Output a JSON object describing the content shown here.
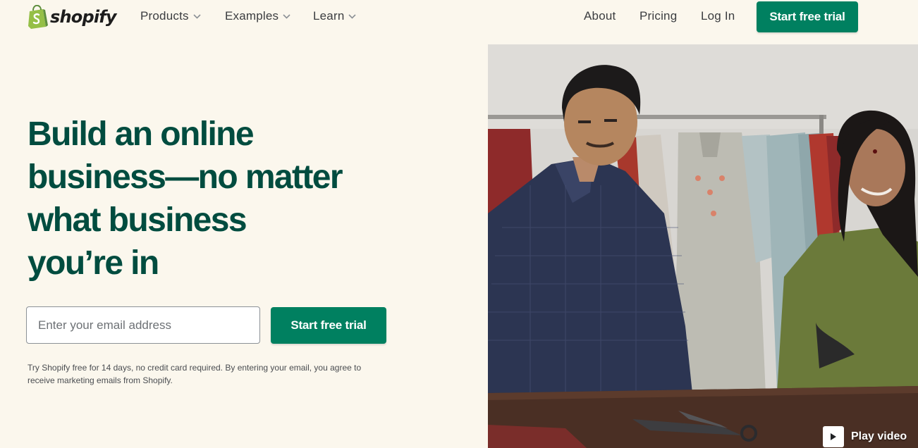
{
  "brand": {
    "name": "shopify",
    "logo_icon": "shopify-bag-icon",
    "colors": {
      "primary_green": "#008060",
      "heading_green": "#004c3f",
      "page_background": "#fbf7ed",
      "logo_bag_green": "#95bf47"
    }
  },
  "nav": {
    "left_items": [
      {
        "label": "Products",
        "icon": "chevron-down-icon"
      },
      {
        "label": "Examples",
        "icon": "chevron-down-icon"
      },
      {
        "label": "Learn",
        "icon": "chevron-down-icon"
      }
    ],
    "right_items": [
      {
        "label": "About"
      },
      {
        "label": "Pricing"
      },
      {
        "label": "Log In"
      }
    ],
    "cta_label": "Start free trial"
  },
  "hero": {
    "title_lines": [
      "Build an online",
      "business—no matter",
      "what business",
      "you’re in"
    ],
    "email_placeholder": "Enter your email address",
    "email_value": "",
    "cta_label": "Start free trial",
    "disclaimer": "Try Shopify free for 14 days, no credit card required. By entering your email, you agree to receive marketing emails from Shopify."
  },
  "video": {
    "play_icon": "play-icon",
    "play_label": "Play video"
  }
}
